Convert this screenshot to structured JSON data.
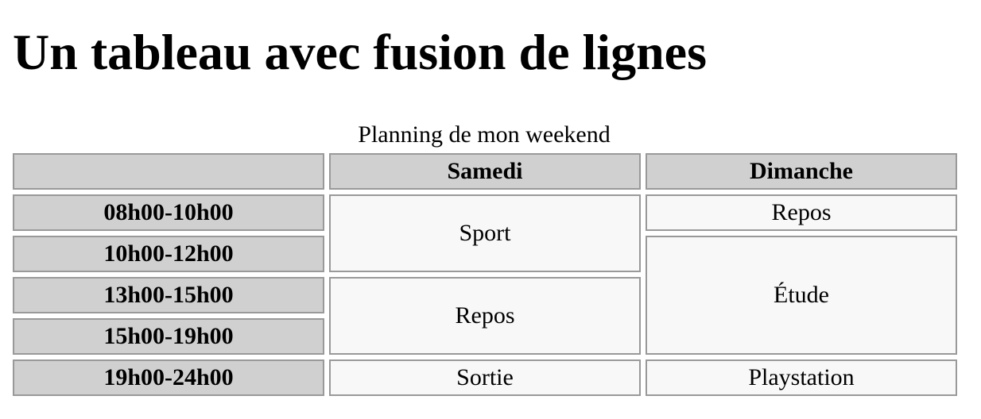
{
  "page": {
    "title": "Un tableau avec fusion de lignes"
  },
  "table": {
    "caption": "Planning de mon weekend",
    "header": {
      "corner": "",
      "col1": "Samedi",
      "col2": "Dimanche"
    },
    "rows": [
      {
        "time": "08h00-10h00"
      },
      {
        "time": "10h00-12h00"
      },
      {
        "time": "13h00-15h00"
      },
      {
        "time": "15h00-19h00"
      },
      {
        "time": "19h00-24h00"
      }
    ],
    "cells": {
      "samedi_sport": "Sport",
      "samedi_repos": "Repos",
      "samedi_sortie": "Sortie",
      "dimanche_repos": "Repos",
      "dimanche_etude": "Étude",
      "dimanche_playstation": "Playstation"
    }
  }
}
